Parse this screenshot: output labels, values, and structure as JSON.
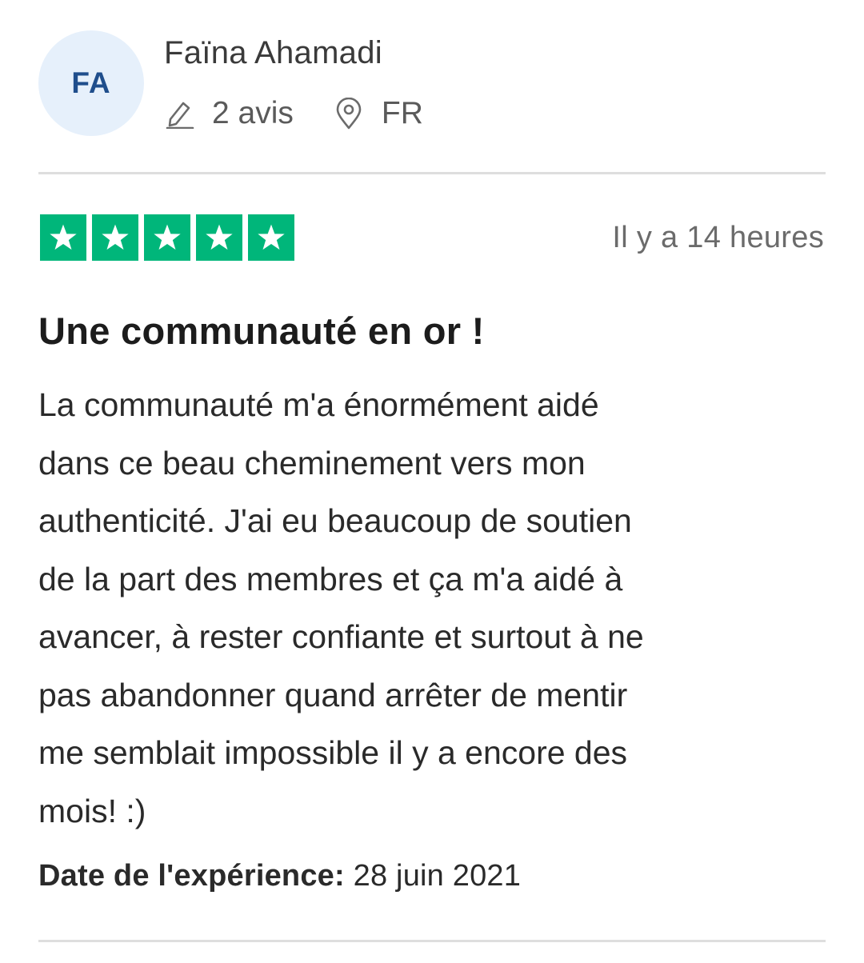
{
  "reviewer": {
    "initials": "FA",
    "name": "Faïna Ahamadi",
    "reviews_count": "2 avis",
    "country": "FR",
    "avatar_bg": "#e6f0fb",
    "avatar_text_color": "#1f4e8c"
  },
  "rating": {
    "stars": 5,
    "max_stars": 5,
    "star_color": "#00b67a",
    "date": "Il y a 14 heures"
  },
  "review": {
    "title": "Une communauté en or !",
    "body_lines": [
      "La communauté m'a énormément aidé",
      "dans ce beau cheminement vers mon",
      "authenticité. J'ai eu beaucoup de soutien",
      "de la part des membres et ça m'a aidé à",
      "avancer, à rester confiante et surtout à ne",
      "pas abandonner quand arrêter de mentir",
      "me semblait impossible il y a encore des",
      "mois! :)"
    ]
  },
  "experience": {
    "label": "Date de l'expérience:",
    "date": "28 juin 2021"
  },
  "icons": {
    "reviews": "pencil-icon",
    "country": "location-pin-icon",
    "star": "star-icon"
  }
}
